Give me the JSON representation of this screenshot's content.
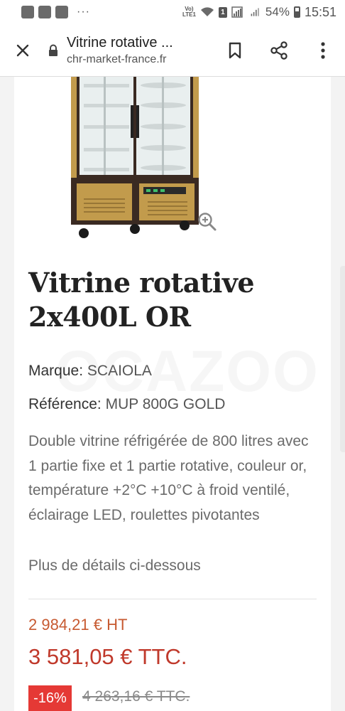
{
  "status_bar": {
    "dots": "···",
    "volte_top": "Vo)",
    "volte_bottom": "LTE1",
    "sim_number": "1",
    "battery_percent": "54%",
    "time": "15:51"
  },
  "browser": {
    "page_title": "Vitrine rotative ...",
    "url": "chr-market-france.fr",
    "icons": [
      "close-icon",
      "lock-icon",
      "bookmark-icon",
      "share-icon",
      "more-vert-icon"
    ]
  },
  "product": {
    "title": "Vitrine rotative 2x400L OR",
    "brand_label": "Marque:",
    "brand_value": "SCAIOLA",
    "ref_label": "Référence:",
    "ref_value": "MUP 800G GOLD",
    "description": "Double vitrine réfrigérée de 800 litres avec 1 partie fixe et 1 partie rotative, couleur or, température +2°C +10°C à froid ventilé, éclairage LED, roulettes pivotantes",
    "more_details": "Plus de détails ci-dessous",
    "watermark": "OCAZOO"
  },
  "pricing": {
    "price_ht": "2 984,21 € HT",
    "price_ttc": "3 581,05 € TTC.",
    "discount": "-16%",
    "old_price": "4 263,16 € TTC."
  },
  "colors": {
    "price_ht": "#c75a31",
    "price_ttc": "#c0392b",
    "discount_badge": "#e53935",
    "cabinet_gold": "#b8913f",
    "cabinet_frame": "#3a2a22"
  }
}
